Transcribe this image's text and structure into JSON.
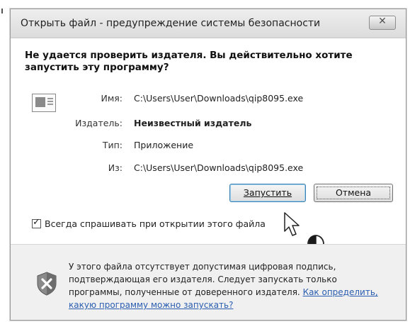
{
  "dialog": {
    "title": "Открыть файл - предупреждение системы безопасности",
    "close_glyph": "✕",
    "heading": "Не удается проверить издателя.  Вы действительно хотите запустить эту программу?",
    "properties": {
      "name_label": "Имя:",
      "name_value": "C:\\Users\\User\\Downloads\\qip8095.exe",
      "publisher_label": "Издатель:",
      "publisher_value": "Неизвестный издатель",
      "type_label": "Тип:",
      "type_value": "Приложение",
      "from_label": "Из:",
      "from_value": "C:\\Users\\User\\Downloads\\qip8095.exe"
    },
    "buttons": {
      "run_label": "Запустить",
      "cancel_label": "Отмена"
    },
    "checkbox": {
      "label": "Всегда спрашивать при открытии этого файла",
      "checked": true
    },
    "footer": {
      "text": "У этого файла отсутствует допустимая цифровая подпись, подтверждающая его издателя. Следует запускать только программы, полученные от доверенного издателя.",
      "link": "Как определить, какую программу можно запускать?"
    },
    "icons": {
      "file": "file-icon",
      "shield": "shield-warning-icon",
      "cursor": "cursor-arrow-icon",
      "mouse": "mouse-icon"
    }
  }
}
